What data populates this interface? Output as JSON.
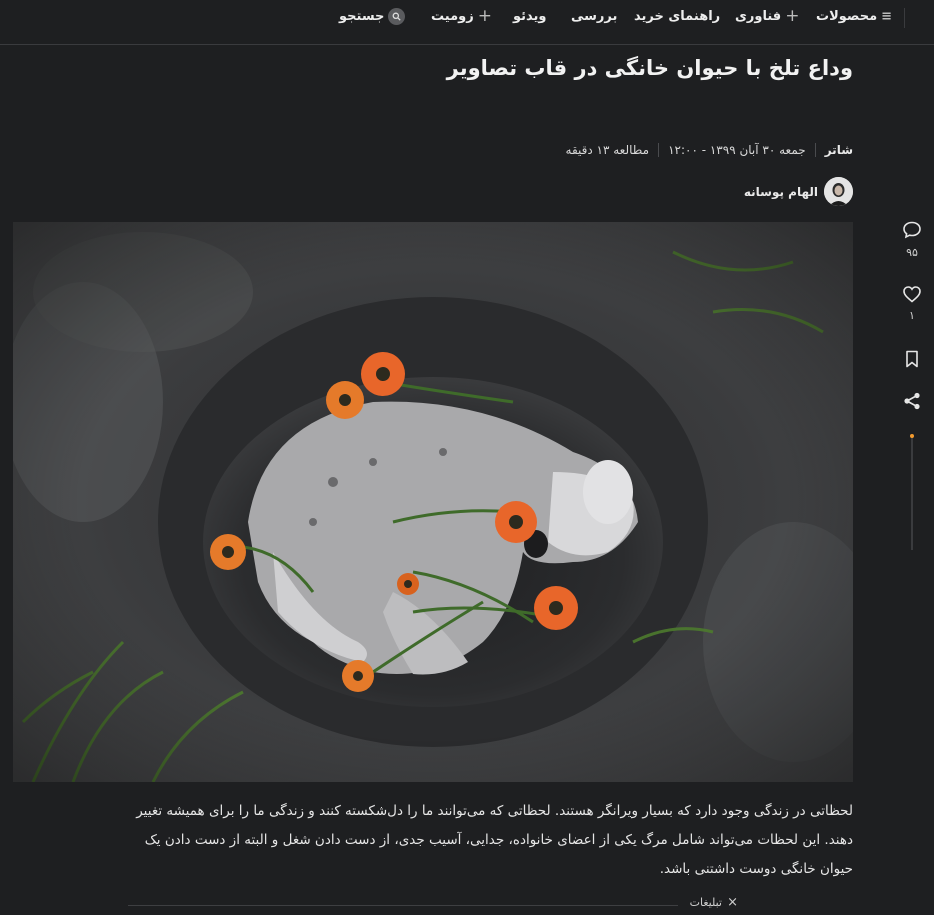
{
  "nav": {
    "products": "محصولات",
    "tech": "فناوری",
    "buying_guide": "راهنمای خرید",
    "review": "بررسی",
    "video": "ویدئو",
    "zoomit": "زومیت",
    "search": "جستجو"
  },
  "article": {
    "title": "وداع تلخ با حیوان خانگی در قاب تصاویر",
    "category": "شاتر",
    "date": "جمعه ۳۰ آبان ۱۳۹۹ - ۱۲:۰۰",
    "read_time": "مطالعه ۱۳ دقیقه",
    "author": "الهام پوسانه",
    "body": "لحظاتی در زندگی وجود دارد که بسیار ویرانگر هستند. لحظاتی که می‌توانند ما را دل‌شکسته کنند و زندگی ما را برای همیشه تغییر دهند. این لحظات می‌تواند شامل مرگ یکی از اعضای خانواده، جدایی، آسیب جدی، از دست دادن شغل و البته از دست دادن یک حیوان خانگی دوست داشتنی باشد."
  },
  "actions": {
    "comments_count": "۹۵",
    "likes_count": "۱"
  },
  "ads": {
    "label": "تبلیغات",
    "close": "×"
  },
  "colors": {
    "background": "#1e1f21",
    "accent": "#f29a2e"
  }
}
